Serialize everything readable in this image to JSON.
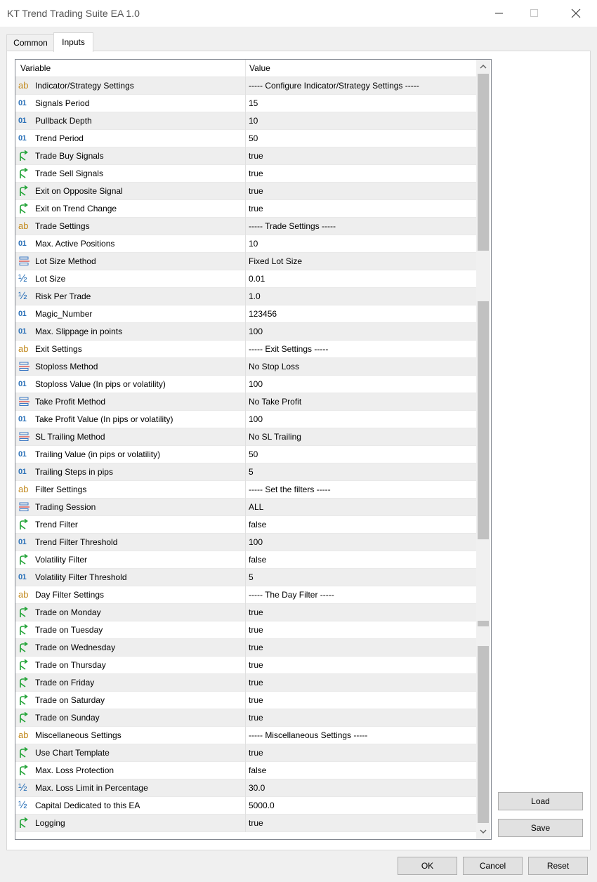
{
  "window": {
    "title": "KT Trend Trading Suite EA 1.0"
  },
  "tabs": [
    {
      "label": "Common",
      "active": false
    },
    {
      "label": "Inputs",
      "active": true
    }
  ],
  "grid": {
    "headers": {
      "variable": "Variable",
      "value": "Value"
    },
    "rows": [
      {
        "type": "string",
        "variable": "Indicator/Strategy Settings",
        "value": "----- Configure Indicator/Strategy Settings -----"
      },
      {
        "type": "int",
        "variable": "Signals Period",
        "value": "15"
      },
      {
        "type": "int",
        "variable": "Pullback Depth",
        "value": "10"
      },
      {
        "type": "int",
        "variable": "Trend Period",
        "value": "50"
      },
      {
        "type": "bool",
        "variable": "Trade Buy Signals",
        "value": "true"
      },
      {
        "type": "bool",
        "variable": "Trade Sell Signals",
        "value": "true"
      },
      {
        "type": "bool",
        "variable": "Exit on Opposite Signal",
        "value": "true"
      },
      {
        "type": "bool",
        "variable": "Exit on Trend Change",
        "value": "true"
      },
      {
        "type": "string",
        "variable": "Trade Settings",
        "value": "----- Trade Settings -----"
      },
      {
        "type": "int",
        "variable": "Max. Active Positions",
        "value": "10"
      },
      {
        "type": "enum",
        "variable": "Lot Size Method",
        "value": "Fixed Lot Size"
      },
      {
        "type": "double",
        "variable": "Lot Size",
        "value": "0.01"
      },
      {
        "type": "double",
        "variable": "Risk Per Trade",
        "value": "1.0"
      },
      {
        "type": "int",
        "variable": "Magic_Number",
        "value": "123456"
      },
      {
        "type": "int",
        "variable": "Max. Slippage in points",
        "value": "100"
      },
      {
        "type": "string",
        "variable": "Exit Settings",
        "value": "----- Exit Settings -----"
      },
      {
        "type": "enum",
        "variable": "Stoploss Method",
        "value": "No Stop Loss"
      },
      {
        "type": "int",
        "variable": "Stoploss Value (In pips or volatility)",
        "value": "100"
      },
      {
        "type": "enum",
        "variable": "Take Profit Method",
        "value": "No Take Profit"
      },
      {
        "type": "int",
        "variable": "Take Profit Value (In pips or volatility)",
        "value": "100"
      },
      {
        "type": "enum",
        "variable": "SL Trailing Method",
        "value": "No SL Trailing"
      },
      {
        "type": "int",
        "variable": "Trailing Value (in pips or volatility)",
        "value": "50"
      },
      {
        "type": "int",
        "variable": "Trailing Steps in pips",
        "value": "5"
      },
      {
        "type": "string",
        "variable": "Filter Settings",
        "value": "----- Set the filters -----"
      },
      {
        "type": "enum",
        "variable": "Trading Session",
        "value": "ALL"
      },
      {
        "type": "bool",
        "variable": "Trend Filter",
        "value": "false"
      },
      {
        "type": "int",
        "variable": "Trend Filter Threshold",
        "value": "100"
      },
      {
        "type": "bool",
        "variable": "Volatility Filter",
        "value": "false"
      },
      {
        "type": "int",
        "variable": "Volatility Filter Threshold",
        "value": "5"
      },
      {
        "type": "string",
        "variable": "Day Filter Settings",
        "value": "----- The Day Filter -----"
      },
      {
        "type": "bool",
        "variable": "Trade on Monday",
        "value": "true"
      },
      {
        "type": "bool",
        "variable": "Trade on Tuesday",
        "value": "true"
      },
      {
        "type": "bool",
        "variable": "Trade on Wednesday",
        "value": "true"
      },
      {
        "type": "bool",
        "variable": "Trade on Thursday",
        "value": "true"
      },
      {
        "type": "bool",
        "variable": "Trade on Friday",
        "value": "true"
      },
      {
        "type": "bool",
        "variable": "Trade on Saturday",
        "value": "true"
      },
      {
        "type": "bool",
        "variable": "Trade on Sunday",
        "value": "true"
      },
      {
        "type": "string",
        "variable": "Miscellaneous Settings",
        "value": "----- Miscellaneous Settings -----"
      },
      {
        "type": "bool",
        "variable": "Use Chart Template",
        "value": "true"
      },
      {
        "type": "bool",
        "variable": "Max. Loss Protection",
        "value": "false"
      },
      {
        "type": "double",
        "variable": "Max. Loss Limit in Percentage",
        "value": "30.0"
      },
      {
        "type": "double",
        "variable": "Capital Dedicated to this EA",
        "value": "5000.0"
      },
      {
        "type": "bool",
        "variable": "Logging",
        "value": "true"
      }
    ]
  },
  "side_buttons": {
    "load": "Load",
    "save": "Save"
  },
  "bottom_buttons": {
    "ok": "OK",
    "cancel": "Cancel",
    "reset": "Reset"
  },
  "icons": {
    "string": "ab",
    "int": "01",
    "double": "½",
    "bool": "arrow-branch-icon",
    "enum": "list-enum-icon"
  },
  "colors": {
    "string_icon": "#c28a1f",
    "numeric_icon": "#2b71b8",
    "bool_icon": "#21a336",
    "enum_icon_blue": "#3b78c4",
    "enum_icon_red": "#d9534f"
  }
}
